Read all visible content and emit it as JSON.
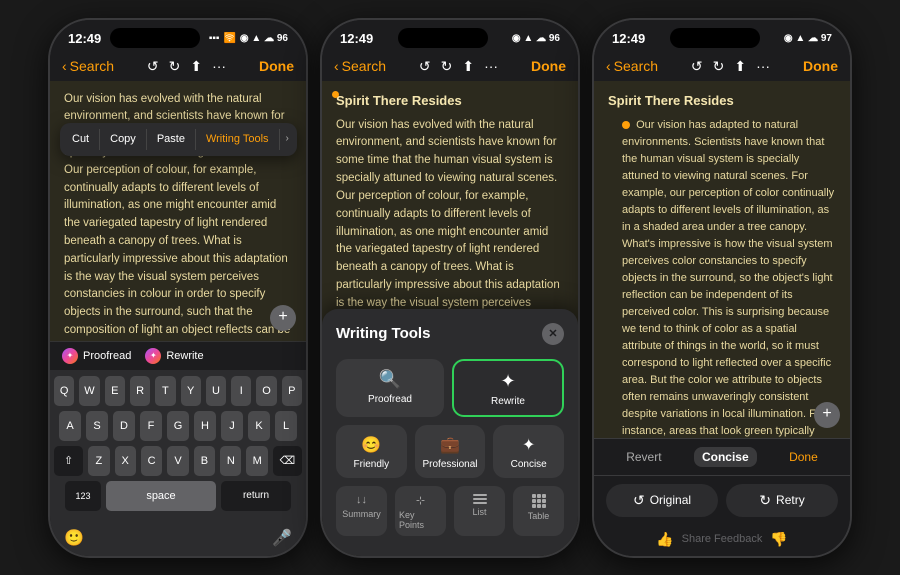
{
  "phones": [
    {
      "id": "phone1",
      "status": {
        "time": "12:49",
        "icons": "◉ ▲ ☁ 96"
      },
      "nav": {
        "back": "Search",
        "done": "Done"
      },
      "content": {
        "text": "Our vision has evolved with the natural environment, and scientists have known for some time that the human visual system is specially attuned to viewing natural scenes. Our perception of colour, for example, continually adapts to different levels of illumination, as one might encounter amid the variegated tapestry of light rendered beneath a canopy of trees. What is particularly impressive about this adaptation is the way the visual system perceives constancies in colour in order to specify objects in the surround, such that the composition of light an object reflects can be literally independent of the colour perceive it to be. This fact strikes most"
      },
      "contextMenu": {
        "items": [
          "Cut",
          "Copy",
          "Paste",
          "Writing Tools"
        ]
      },
      "proofread": {
        "proofreadLabel": "Proofread",
        "rewriteLabel": "Rewrite"
      },
      "keyboard": {
        "rows": [
          [
            "Q",
            "W",
            "E",
            "R",
            "T",
            "Y",
            "U",
            "I",
            "O",
            "P"
          ],
          [
            "A",
            "S",
            "D",
            "F",
            "G",
            "H",
            "J",
            "K",
            "L"
          ],
          [
            "⇧",
            "Z",
            "X",
            "C",
            "V",
            "B",
            "N",
            "M",
            "⌫"
          ],
          [
            "123",
            "space",
            "return"
          ]
        ]
      }
    },
    {
      "id": "phone2",
      "status": {
        "time": "12:49",
        "icons": "◉ ▲ ☁ 96"
      },
      "nav": {
        "back": "Search",
        "done": "Done"
      },
      "noteTitle": "Spirit There Resides",
      "content": {
        "text": "Our vision has evolved with the natural environment, and scientists have known for some time that the human visual system is specially attuned to viewing natural scenes. Our perception of colour, for example, continually adapts to different levels of illumination, as one might encounter amid the variegated tapestry of light rendered beneath a canopy of trees. What is particularly impressive about this adaptation is the way the visual system perceives constancies in colour in order to specify objects in the surround, such tho the composition of light an object reflects"
      },
      "writingTools": {
        "title": "Writing Tools",
        "tools": [
          {
            "icon": "🔍",
            "label": "Proofread",
            "highlighted": false
          },
          {
            "icon": "✦",
            "label": "Rewrite",
            "highlighted": true
          }
        ],
        "tones": [
          {
            "icon": "😊",
            "label": "Friendly"
          },
          {
            "icon": "💼",
            "label": "Professional"
          },
          {
            "icon": "✦",
            "label": "Concise"
          }
        ],
        "extras": [
          {
            "icon": "summary",
            "label": "Summary"
          },
          {
            "icon": "keypoints",
            "label": "Key Points"
          },
          {
            "icon": "list",
            "label": "List"
          },
          {
            "icon": "table",
            "label": "Table"
          }
        ]
      }
    },
    {
      "id": "phone3",
      "status": {
        "time": "12:49",
        "icons": "◉ ▲ ☁ 97"
      },
      "nav": {
        "back": "Search",
        "done": "Done"
      },
      "noteTitle": "Spirit There Resides",
      "content": {
        "text": "Our vision has adapted to natural environments. Scientists have known that the human visual system is specially attuned to viewing natural scenes. For example, our perception of color continually adapts to different levels of illumination, as in a shaded area under a tree canopy. What's impressive is how the visual system perceives color constancies to specify objects in the surround, so the object's light reflection can be independent of its perceived color. This is surprising because we tend to think of color as a spatial attribute of things in the world, so it must correspond to light reflected over a specific area. But the color we attribute to objects often remains unwaveringly consistent despite variations in local illumination. For instance, areas that look green typically"
      },
      "conciseBar": {
        "revert": "Revert",
        "concise": "Concise",
        "done": "Done"
      },
      "actions": {
        "original": "Original",
        "retry": "Retry"
      },
      "feedback": {
        "shareText": "Share Feedback"
      }
    }
  ]
}
